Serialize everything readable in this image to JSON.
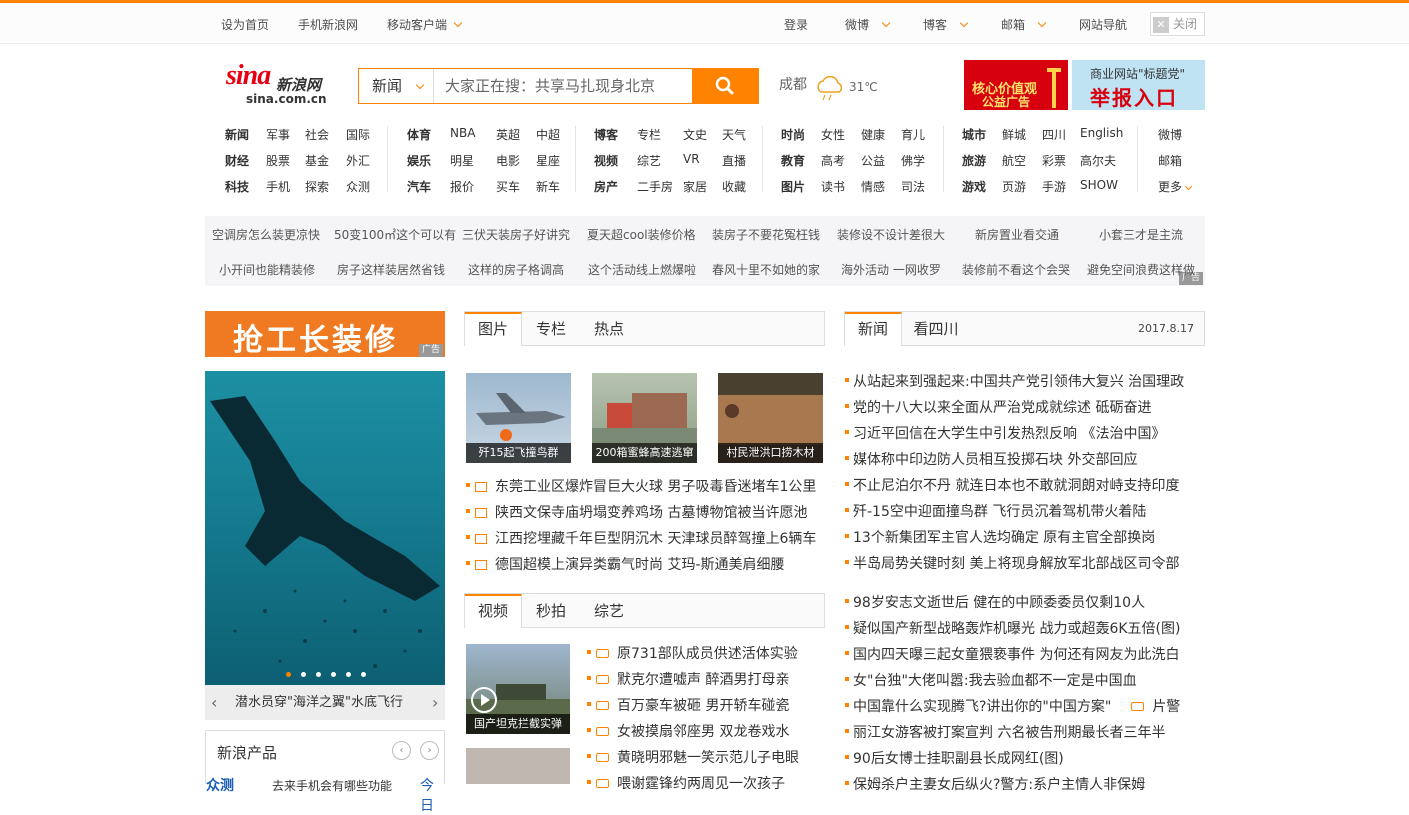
{
  "topbar": {
    "set_home": "设为首页",
    "mobile_sina": "手机新浪网",
    "mobile_client": "移动客户端",
    "login": "登录",
    "weibo": "微博",
    "blog": "博客",
    "mail": "邮箱",
    "site_nav": "网站导航",
    "close": "关闭"
  },
  "logo": {
    "mark": "sina",
    "cn": "新浪网",
    "domain": "sina.com.cn"
  },
  "search": {
    "category": "新闻",
    "placeholder": "大家正在搜：共享马扎现身北京"
  },
  "weather": {
    "city": "成都",
    "temp": "31℃"
  },
  "ads_top": {
    "ad1_line1": "核心价值观",
    "ad1_line2": "公益广告",
    "ad2_line1": "商业网站\"标题党\"",
    "ad2_line2": "举报入口"
  },
  "nav": {
    "col1": [
      [
        "新闻",
        "军事",
        "社会",
        "国际"
      ],
      [
        "财经",
        "股票",
        "基金",
        "外汇"
      ],
      [
        "科技",
        "手机",
        "探索",
        "众测"
      ]
    ],
    "col2": [
      [
        "体育",
        "NBA",
        "英超",
        "中超"
      ],
      [
        "娱乐",
        "明星",
        "电影",
        "星座"
      ],
      [
        "汽车",
        "报价",
        "买车",
        "新车"
      ]
    ],
    "col3": [
      [
        "博客",
        "专栏",
        "文史",
        "天气"
      ],
      [
        "视频",
        "综艺",
        "VR",
        "直播"
      ],
      [
        "房产",
        "二手房",
        "家居",
        "收藏"
      ]
    ],
    "col4": [
      [
        "时尚",
        "女性",
        "健康",
        "育儿"
      ],
      [
        "教育",
        "高考",
        "公益",
        "佛学"
      ],
      [
        "图片",
        "读书",
        "情感",
        "司法"
      ]
    ],
    "col5": [
      [
        "城市",
        "鲜城",
        "四川",
        "English"
      ],
      [
        "旅游",
        "航空",
        "彩票",
        "高尔夫"
      ],
      [
        "游戏",
        "页游",
        "手游",
        "SHOW"
      ]
    ],
    "col6": [
      "微博",
      "邮箱",
      "更多"
    ]
  },
  "ad_links": {
    "row1": [
      "空调房怎么装更凉快",
      "50变100㎡这个可以有",
      "三伏天装房子好讲究",
      "夏天超cool装修价格",
      "装房子不要花冤枉钱",
      "装修设不设计差很大",
      "新房置业看交通",
      "小套三才是主流"
    ],
    "row2": [
      "小开间也能精装修",
      "房子这样装居然省钱",
      "这样的房子格调高",
      "这个活动线上燃爆啦",
      "春风十里不如她的家",
      "海外活动 一网收罗",
      "装修前不看这个会哭",
      "避免空间浪费这样做"
    ],
    "tag": "广告"
  },
  "left": {
    "big_ad": "抢工长装修",
    "ad_tag": "广告",
    "photo_caption": "潜水员穿\"海洋之翼\"水底飞行",
    "products_title": "新浪产品",
    "products_tab": "众测",
    "products_text": "去来手机会有哪些功能",
    "products_tail": "今日"
  },
  "picture_block": {
    "tabs": [
      "图片",
      "专栏",
      "热点"
    ],
    "thumbs": [
      "歼15起飞撞鸟群",
      "200箱蜜蜂高速逃窜",
      "村民泄洪口捞木材"
    ],
    "news": [
      "东莞工业区爆炸冒巨大火球  男子吸毒昏迷堵车1公里",
      "陕西文保寺庙坍塌变养鸡场  古墓博物馆被当许愿池",
      "江西挖埋藏千年巨型阴沉木  天津球员醉驾撞上6辆车",
      "德国超模上演异类霸气时尚  艾玛-斯通美肩细腰"
    ]
  },
  "video_block": {
    "tabs": [
      "视频",
      "秒拍",
      "综艺"
    ],
    "thumb_caption": "国产坦克拦截实弹",
    "news": [
      "原731部队成员供述活体实验",
      "默克尔遭嘘声  醉酒男打母亲",
      "百万豪车被砸  男开轿车碰瓷",
      "女被摸扇邻座男  双龙卷戏水",
      "黄晓明邪魅一笑示范儿子电眼",
      "喂谢霆锋约两周见一次孩子"
    ]
  },
  "news_block": {
    "tabs": [
      "新闻",
      "看四川"
    ],
    "date": "2017.8.17",
    "top": [
      "从站起来到强起来:中国共产党引领伟大复兴  治国理政",
      "党的十八大以来全面从严治党成就综述  砥砺奋进",
      "习近平回信在大学生中引发热烈反响  《法治中国》",
      "媒体称中印边防人员相互投掷石块  外交部回应",
      "不止尼泊尔不丹  就连日本也不敢就洞朗对峙支持印度",
      "歼-15空中迎面撞鸟群  飞行员沉着驾机带火着陆",
      "13个新集团军主官人选均确定  原有主官全部换岗",
      "半岛局势关键时刻  美上将现身解放军北部战区司令部"
    ],
    "more": [
      "98岁安志文逝世后  健在的中顾委委员仅剩10人",
      "疑似国产新型战略轰炸机曝光  战力或超轰6K五倍(图)",
      "国内四天曝三起女童猥亵事件  为何还有网友为此洗白",
      "女\"台独\"大佬叫嚣:我去验血都不一定是中国血",
      "中国靠什么实现腾飞?讲出你的\"中国方案\"",
      "丽江女游客被打案宣判  六名被告刑期最长者三年半",
      "90后女博士挂职副县长成网红(图)",
      "保姆杀户主妻女后纵火?警方:系户主情人非保姆"
    ],
    "video_tail": "片警"
  },
  "colors": {
    "accent": "#ff8200",
    "brand_red": "#e60012"
  }
}
